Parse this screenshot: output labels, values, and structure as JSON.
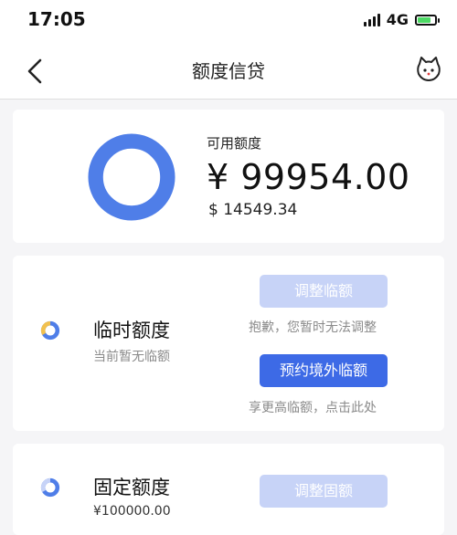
{
  "status_bar": {
    "time": "17:05",
    "network": "4G",
    "icons": [
      "signal-icon",
      "battery-icon"
    ]
  },
  "nav": {
    "title": "额度信贷",
    "icons": [
      "back-icon",
      "cat-icon"
    ]
  },
  "balance": {
    "label": "可用额度",
    "amount": "¥ 99954.00",
    "usd_amount": "$ 14549.34"
  },
  "temp_quota": {
    "title": "临时额度",
    "subtitle": "当前暂无临额",
    "adjust_button": "调整临额",
    "sorry_text": "抱歉，您暂时无法调整",
    "reserve_button": "预约境外临额",
    "enjoy_text": "享更高临额，点击此处"
  },
  "fixed_quota": {
    "title": "固定额度",
    "amount": "¥100000.00",
    "adjust_button": "调整固额"
  },
  "colors": {
    "accent": "#3d6ae6",
    "accent_disabled": "#c7d3f7",
    "ring_blue": "#4f7ee8",
    "ring_yellow": "#f2c14e",
    "battery_green": "#4cd964"
  }
}
